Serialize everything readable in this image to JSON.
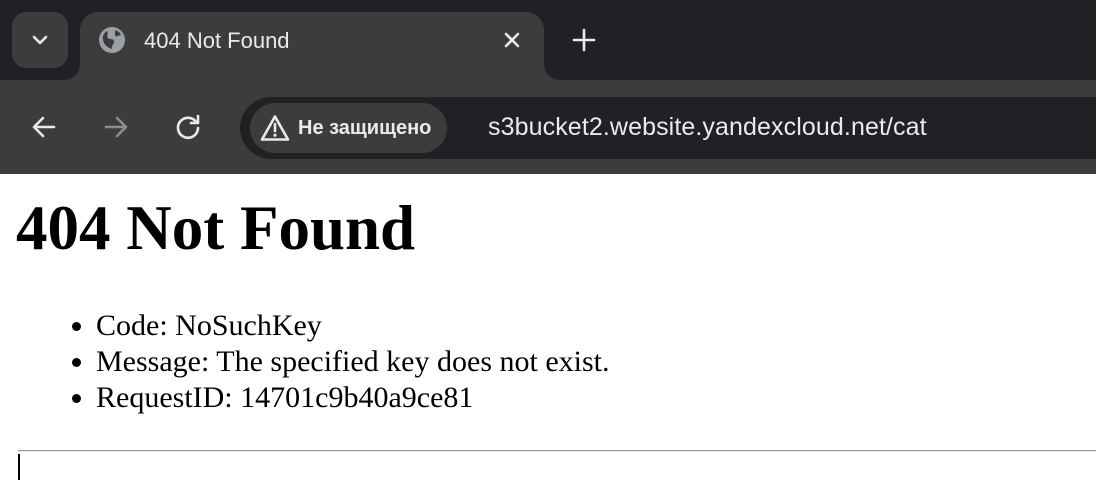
{
  "browser": {
    "tab": {
      "title": "404 Not Found",
      "favicon_icon": "globe-icon",
      "close_icon": "close-icon"
    },
    "tab_search_icon": "chevron-down-icon",
    "new_tab_icon": "plus-icon",
    "nav": {
      "back_icon": "arrow-left-icon",
      "forward_icon": "arrow-right-icon",
      "reload_icon": "reload-icon"
    },
    "omnibox": {
      "security_icon": "warning-icon",
      "security_label": "Не защищено",
      "url": "s3bucket2.website.yandexcloud.net/cat"
    },
    "colors": {
      "tabstrip": "#202124",
      "toolbar": "#3c3c3c",
      "text": "#e8eaed",
      "disabled": "#8e8e8e"
    }
  },
  "page": {
    "heading": "404 Not Found",
    "details": [
      "Code: NoSuchKey",
      "Message: The specified key does not exist.",
      "RequestID: 14701c9b40a9ce81"
    ]
  }
}
